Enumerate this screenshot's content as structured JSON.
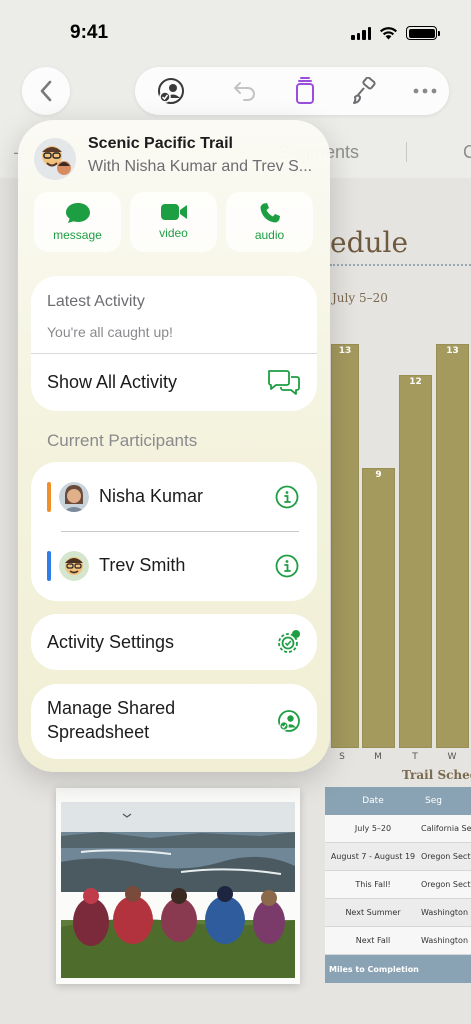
{
  "status_bar": {
    "time": "9:41"
  },
  "background": {
    "tabs": [
      "–",
      "Segments",
      "C"
    ],
    "chart": {
      "title": "edule",
      "subtitle": "July 5–20",
      "bars": [
        {
          "label": "S",
          "value": "13"
        },
        {
          "label": "M",
          "value": "9"
        },
        {
          "label": "T",
          "value": "12"
        },
        {
          "label": "W",
          "value": "13"
        }
      ]
    },
    "table": {
      "caption": "Trail Sched",
      "headers": [
        "Date",
        "Seg"
      ],
      "rows": [
        [
          "July 5–20",
          "California Secti"
        ],
        [
          "August 7 - August 19",
          "Oregon Section"
        ],
        [
          "This Fall!",
          "Oregon Section"
        ],
        [
          "Next Summer",
          "Washington Sec"
        ],
        [
          "Next Fall",
          "Washington Sec"
        ]
      ],
      "footer": "Miles to Completion"
    }
  },
  "popover": {
    "title": "Scenic Pacific Trail",
    "subtitle": "With Nisha Kumar and Trev S...",
    "actions": [
      {
        "label": "message",
        "icon": "message-icon"
      },
      {
        "label": "video",
        "icon": "video-icon"
      },
      {
        "label": "audio",
        "icon": "phone-icon"
      }
    ],
    "latest_activity": {
      "header": "Latest Activity",
      "status": "You're all caught up!",
      "show_all": "Show All Activity"
    },
    "participants_title": "Current Participants",
    "participants": [
      {
        "name": "Nisha Kumar",
        "color": "#f0902a"
      },
      {
        "name": "Trev Smith",
        "color": "#2f7ee8"
      }
    ],
    "activity_settings": "Activity Settings",
    "manage_shared": [
      "Manage Shared",
      "Spreadsheet"
    ]
  },
  "colors": {
    "accent_green": "#1e9e43",
    "toolbar_purple": "#9b4ddb"
  }
}
